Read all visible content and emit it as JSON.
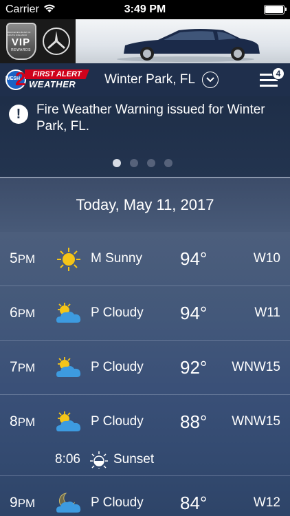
{
  "status_bar": {
    "carrier": "Carrier",
    "time": "3:49 PM"
  },
  "ad": {
    "vip_small_text": "MERCEDES-BENZ OF SOUTH ORLANDO",
    "vip_text": "VIP",
    "vip_rewards": "REWARDS"
  },
  "header": {
    "logo_first_alert": "FIRST ALERT",
    "logo_weather": "WEATHER",
    "logo_channel": "2",
    "logo_station": "WESH",
    "location": "Winter Park, FL",
    "menu_badge": "4"
  },
  "alert": {
    "text": "Fire Weather Warning issued for Winter Park, FL.",
    "page_count": 4,
    "active_page": 1
  },
  "day_heading": "Today, May 11, 2017",
  "forecast": [
    {
      "hour": "5",
      "ampm": "PM",
      "icon": "sunny-icon",
      "condition": "M Sunny",
      "temp": "94°",
      "wind": "W10"
    },
    {
      "hour": "6",
      "ampm": "PM",
      "icon": "partly-cloudy-icon",
      "condition": "P Cloudy",
      "temp": "94°",
      "wind": "W11"
    },
    {
      "hour": "7",
      "ampm": "PM",
      "icon": "partly-cloudy-icon",
      "condition": "P Cloudy",
      "temp": "92°",
      "wind": "WNW15"
    },
    {
      "hour": "8",
      "ampm": "PM",
      "icon": "partly-cloudy-icon",
      "condition": "P Cloudy",
      "temp": "88°",
      "wind": "WNW15"
    },
    {
      "hour": "9",
      "ampm": "PM",
      "icon": "partly-cloudy-night-icon",
      "condition": "P Cloudy",
      "temp": "84°",
      "wind": "W12"
    }
  ],
  "sunset": {
    "time": "8:06",
    "label": "Sunset",
    "icon": "sunset-icon"
  },
  "colors": {
    "header_bg": "#1f2f4c",
    "sun": "#f5c518",
    "cloud": "#3d9be0",
    "logo_red": "#d0021b"
  }
}
